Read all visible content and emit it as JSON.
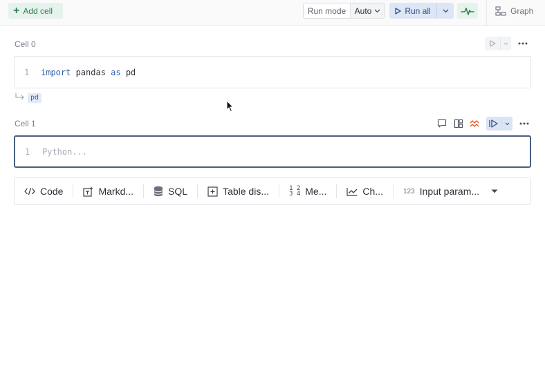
{
  "toolbar": {
    "add_cell_label": "Add cell",
    "run_mode_label": "Run mode",
    "run_mode_value": "Auto",
    "run_all_label": "Run all",
    "graph_label": "Graph"
  },
  "cells": [
    {
      "label": "Cell 0",
      "line_number": "1",
      "code": {
        "kw1": "import",
        "mid": " pandas ",
        "kw2": "as",
        "end": " pd"
      },
      "output_var": "pd"
    },
    {
      "label": "Cell 1",
      "line_number": "1",
      "placeholder": "Python..."
    }
  ],
  "cell_types": [
    {
      "label": "Code",
      "icon": "code-icon"
    },
    {
      "label": "Markd...",
      "icon": "markdown-icon"
    },
    {
      "label": "SQL",
      "icon": "database-icon"
    },
    {
      "label": "Table dis...",
      "icon": "table-display-icon"
    },
    {
      "label": "Me...",
      "icon": "metric-icon",
      "icon_text_top": "1 2",
      "icon_text_bottom": "3 4"
    },
    {
      "label": "Ch...",
      "icon": "chart-icon"
    },
    {
      "label": "Input param...",
      "icon": "input-parameter-icon",
      "icon_text": "123"
    }
  ],
  "colors": {
    "accent_green": "#2f7d4f",
    "accent_blue": "#2d4f8f",
    "active_border": "#4a5e80",
    "warning_orange": "#e2572b"
  }
}
